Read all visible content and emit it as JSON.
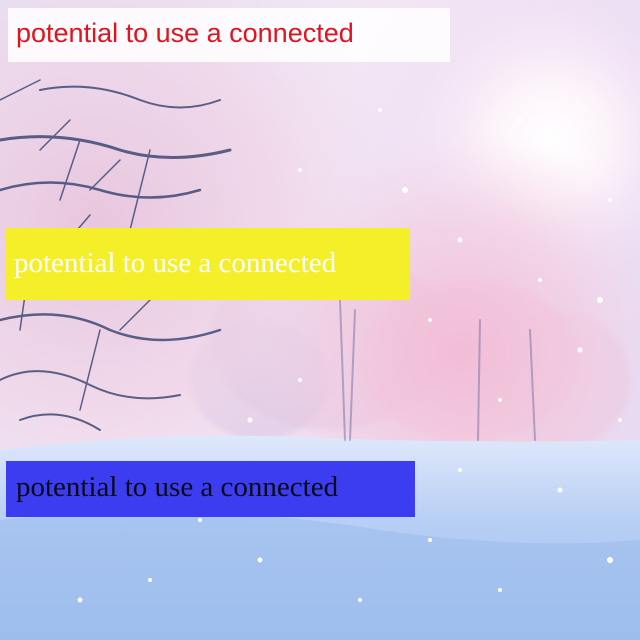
{
  "captions": {
    "top": {
      "text": "potential to use a connected",
      "text_color": "#e0141e",
      "background": "rgba(255,255,255,0.85)"
    },
    "middle": {
      "text": "potential to use a connected",
      "text_color": "#ffffff",
      "background": "#f5ef2a"
    },
    "bottom": {
      "text": "potential to use a connected",
      "text_color": "#0a0a1a",
      "background": "#3c3cf0"
    }
  },
  "palette": {
    "sky_light": "#f6e8f6",
    "sky_lavender": "#cdd4f4",
    "snow_blue": "#a9c8f2",
    "tree_pink": "#f3c7da",
    "branch_dark": "#2e3a6a",
    "sun_glow": "#ffffff"
  }
}
